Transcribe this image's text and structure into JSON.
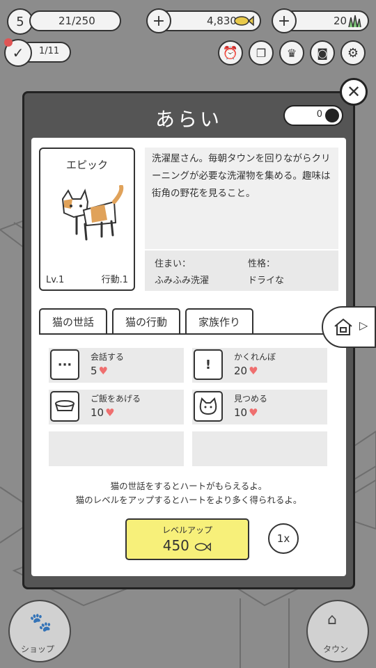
{
  "hud": {
    "level": "5",
    "progress_text": "21/250",
    "fish_count": "4,830",
    "grass_count": "20",
    "mission_text": "1/11",
    "tool_icons": [
      "alarm-clock-icon",
      "album-icon",
      "trophy-icon",
      "camera-icon",
      "gear-icon"
    ]
  },
  "modal": {
    "title": "あらい",
    "coin_count": "0"
  },
  "cat": {
    "rarity": "エピック",
    "level": "Lv.1",
    "action": "行動.1",
    "description": "洗濯屋さん。毎朝タウンを回りながらクリーニングが必要な洗濯物を集める。趣味は街角の野花を見ること。",
    "home_label": "住まい：",
    "home_value": "ふみふみ洗濯",
    "personality_label": "性格：",
    "personality_value": "ドライな"
  },
  "tabs": [
    {
      "label": "猫の世話"
    },
    {
      "label": "猫の行動"
    },
    {
      "label": "家族作り"
    }
  ],
  "actions": [
    {
      "label": "会話する",
      "value": "5"
    },
    {
      "label": "かくれんぼ",
      "value": "20"
    },
    {
      "label": "ご飯をあげる",
      "value": "10"
    },
    {
      "label": "見つめる",
      "value": "10"
    }
  ],
  "message": {
    "line1": "猫の世話をするとハートがもらえるよ。",
    "line2": "猫のレベルをアップするとハートをより多く得られるよ。"
  },
  "level_up": {
    "label": "レベルアップ",
    "cost": "450"
  },
  "multiplier": "1x",
  "bottom": {
    "shop_label": "ショップ",
    "town_label": "タウン"
  },
  "colors": {
    "level_up_bg": "#f7f07a",
    "heart": "#ef6f6f",
    "modal_header": "#555555",
    "overlay": "#8c8c8c"
  }
}
